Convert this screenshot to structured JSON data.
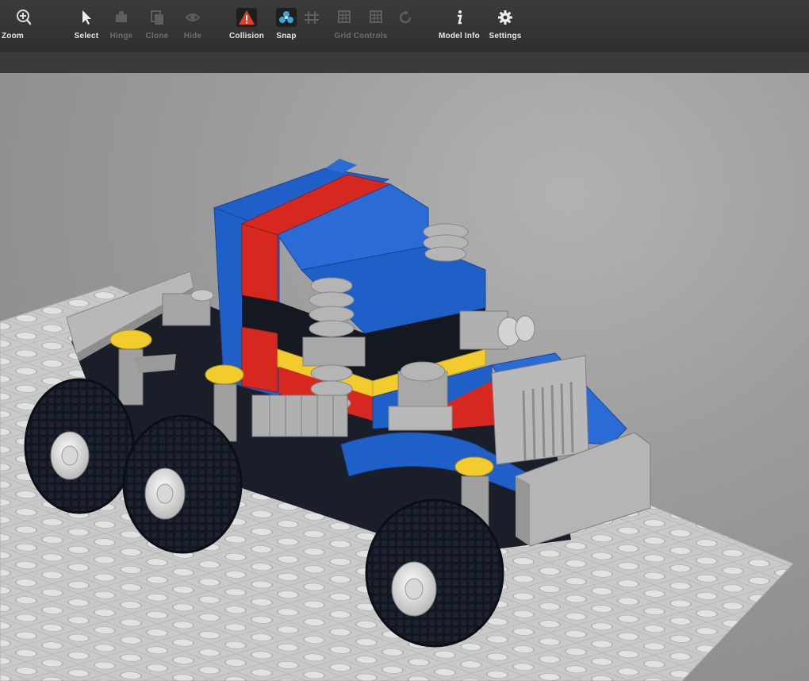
{
  "toolbar": {
    "tools": [
      {
        "label": "Zoom",
        "icon": "zoom-in-icon",
        "enabled": true
      },
      {
        "label": "Select",
        "icon": "cursor-icon",
        "enabled": true
      },
      {
        "label": "Hinge",
        "icon": "hinge-icon",
        "enabled": false
      },
      {
        "label": "Clone",
        "icon": "clone-icon",
        "enabled": false
      },
      {
        "label": "Hide",
        "icon": "hide-icon",
        "enabled": false
      },
      {
        "label": "Collision",
        "icon": "warning-icon",
        "enabled": true,
        "active": true
      },
      {
        "label": "Snap",
        "icon": "snap-icon",
        "enabled": true,
        "active": true
      },
      {
        "label": "Grid Controls",
        "icon": "grid-icon",
        "enabled": false
      },
      {
        "label": "Model Info",
        "icon": "info-icon",
        "enabled": true
      },
      {
        "label": "Settings",
        "icon": "gear-icon",
        "enabled": true
      }
    ]
  },
  "colors": {
    "toolbar_bg": "#333333",
    "viewport_bg": "#9a9a9a",
    "collision_accent": "#e0402a",
    "snap_accent": "#3aa6d8",
    "brick_blue": "#1f5fc8",
    "brick_red": "#d6281f",
    "brick_yellow": "#f2cc2c",
    "brick_gray": "#a9a9a9",
    "brick_black": "#141821",
    "baseplate": "#cfcfcf"
  }
}
